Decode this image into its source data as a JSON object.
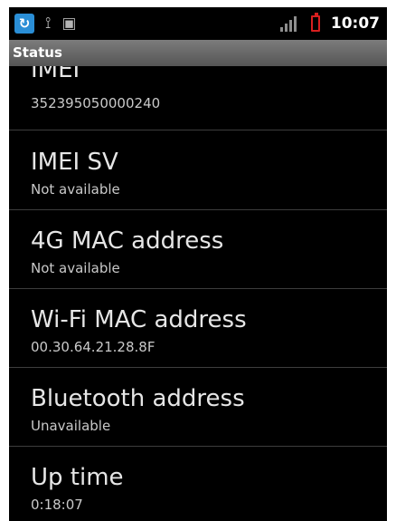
{
  "status_bar": {
    "time": "10:07",
    "left_icons": [
      "sync-icon",
      "usb-icon",
      "android-debug-icon"
    ],
    "right_icons": [
      "signal-icon",
      "battery-icon"
    ],
    "colors": {
      "sync": "#2a8ed6",
      "battery": "#d81f1f"
    }
  },
  "title_bar": {
    "title": "Status"
  },
  "items": [
    {
      "title": "IMEI",
      "value": "352395050000240"
    },
    {
      "title": "IMEI SV",
      "value": "Not available"
    },
    {
      "title": "4G MAC address",
      "value": "Not available"
    },
    {
      "title": "Wi-Fi MAC address",
      "value": "00.30.64.21.28.8F"
    },
    {
      "title": "Bluetooth address",
      "value": "Unavailable"
    },
    {
      "title": "Up time",
      "value": "0:18:07"
    }
  ]
}
